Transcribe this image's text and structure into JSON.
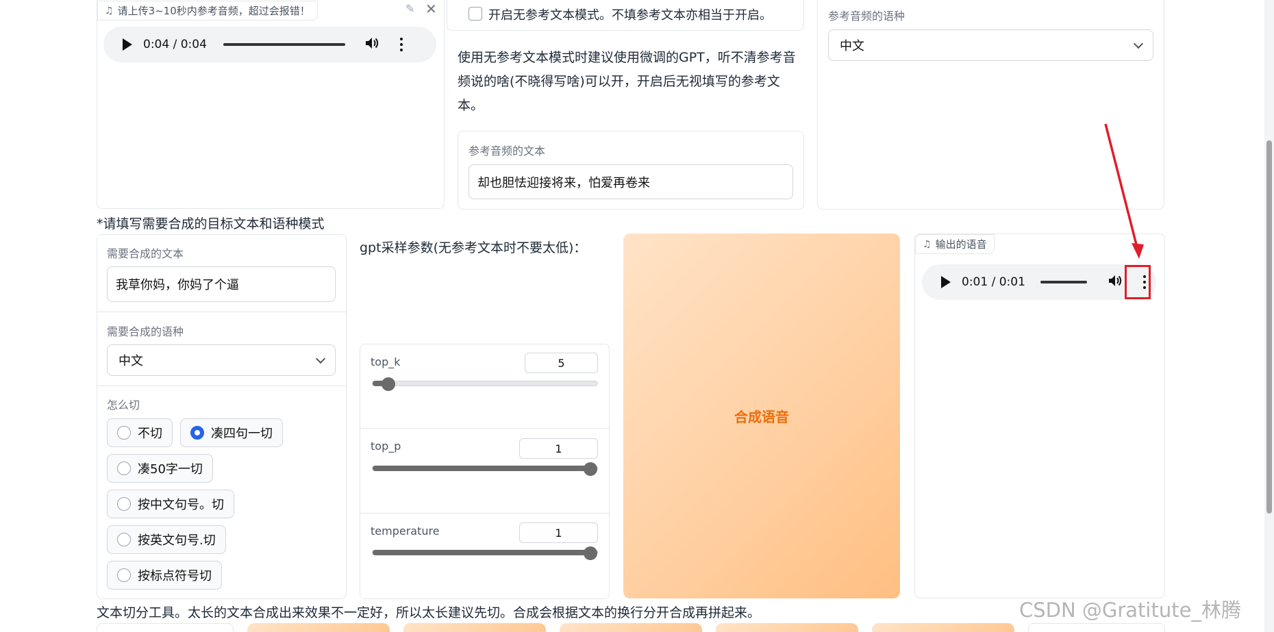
{
  "ref_audio": {
    "label": "请上传3~10秒内参考音频，超过会报错！",
    "time": "0:04 / 0:04"
  },
  "no_ref": {
    "checkbox_label": "开启无参考文本模式。不填参考文本亦相当于开启。",
    "help_text": "使用无参考文本模式时建议使用微调的GPT，听不清参考音频说的啥(不晓得写啥)可以开，开启后无视填写的参考文本。"
  },
  "ref_text": {
    "label": "参考音频的文本",
    "value": "却也胆怯迎接将来，怕爱再卷来"
  },
  "ref_lang": {
    "label": "参考音频的语种",
    "value": "中文"
  },
  "section_title": "*请填写需要合成的目标文本和语种模式",
  "target_text": {
    "label": "需要合成的文本",
    "value": "我草你妈，你妈了个逼"
  },
  "target_lang": {
    "label": "需要合成的语种",
    "value": "中文"
  },
  "cut": {
    "label": "怎么切",
    "options": [
      "不切",
      "凑四句一切",
      "凑50字一切",
      "按中文句号。切",
      "按英文句号.切",
      "按标点符号切"
    ],
    "selected": "凑四句一切"
  },
  "gpt": {
    "title": "gpt采样参数(无参考文本时不要太低)：",
    "top_k": {
      "label": "top_k",
      "value": "5",
      "fraction": 0.07
    },
    "top_p": {
      "label": "top_p",
      "value": "1",
      "fraction": 1.0
    },
    "temperature": {
      "label": "temperature",
      "value": "1",
      "fraction": 1.0
    }
  },
  "generate_button": "合成语音",
  "output_audio": {
    "label": "输出的语音",
    "time": "0:01 / 0:01"
  },
  "footer_text": "文本切分工具。太长的文本合成出来效果不一定好，所以太长建议先切。合成会根据文本的换行分开合成再拼起来。",
  "watermark": "CSDN @Gratitute_林腾",
  "colors": {
    "accent_blue": "#2563eb",
    "button_orange_text": "#ea6d0c",
    "annotation_red": "#e11d2b"
  }
}
